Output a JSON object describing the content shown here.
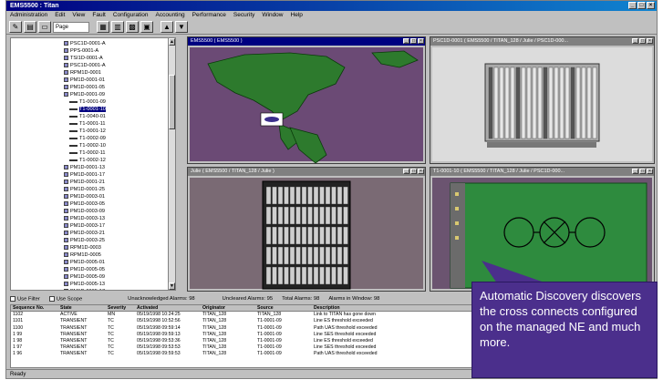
{
  "window": {
    "title": "EMS5500 : Titan",
    "ready": "Ready"
  },
  "menu": [
    "Administration",
    "Edit",
    "View",
    "Fault",
    "Configuration",
    "Accounting",
    "Performance",
    "Security",
    "Window",
    "Help"
  ],
  "toolbar": {
    "page_select": "Page"
  },
  "tree": {
    "rows": [
      {
        "label": "PSC1D-0001-A",
        "kind": "box"
      },
      {
        "label": "PPS-0001-A",
        "kind": "box"
      },
      {
        "label": "TSI1D-0001-A",
        "kind": "box"
      },
      {
        "label": "PSC1D-0001-A",
        "kind": "box"
      },
      {
        "label": "RPM1D-0001",
        "kind": "box"
      },
      {
        "label": "PM1D-0001-01",
        "kind": "box"
      },
      {
        "label": "PM1D-0001-05",
        "kind": "box"
      },
      {
        "label": "PM1D-0001-09",
        "kind": "box"
      },
      {
        "label": "T1-0001-09",
        "kind": "line"
      },
      {
        "label": "T1-0001-10",
        "kind": "line",
        "selected": true
      },
      {
        "label": "T1-0040-01",
        "kind": "line"
      },
      {
        "label": "T1-0001-11",
        "kind": "line"
      },
      {
        "label": "T1-0001-12",
        "kind": "line"
      },
      {
        "label": "T1-0002-09",
        "kind": "line"
      },
      {
        "label": "T1-0002-10",
        "kind": "line"
      },
      {
        "label": "T1-0002-11",
        "kind": "line"
      },
      {
        "label": "T1-0002-12",
        "kind": "line"
      },
      {
        "label": "PM1D-0001-13",
        "kind": "box"
      },
      {
        "label": "PM1D-0001-17",
        "kind": "box"
      },
      {
        "label": "PM1D-0001-21",
        "kind": "box"
      },
      {
        "label": "PM1D-0001-25",
        "kind": "box"
      },
      {
        "label": "PM1D-0003-01",
        "kind": "box"
      },
      {
        "label": "PM1D-0003-05",
        "kind": "box"
      },
      {
        "label": "PM1D-0003-09",
        "kind": "box"
      },
      {
        "label": "PM1D-0003-13",
        "kind": "box"
      },
      {
        "label": "PM1D-0003-17",
        "kind": "box"
      },
      {
        "label": "PM1D-0003-21",
        "kind": "box"
      },
      {
        "label": "PM1D-0003-25",
        "kind": "box"
      },
      {
        "label": "RPM1D-0003",
        "kind": "box"
      },
      {
        "label": "RPM1D-0005",
        "kind": "box"
      },
      {
        "label": "PM1D-0005-01",
        "kind": "box"
      },
      {
        "label": "PM1D-0005-05",
        "kind": "box"
      },
      {
        "label": "PM1D-0005-09",
        "kind": "box"
      },
      {
        "label": "PM1D-0005-13",
        "kind": "box"
      },
      {
        "label": "PM1D-0005-17",
        "kind": "box"
      },
      {
        "label": "PM1D-0005-21",
        "kind": "box"
      }
    ]
  },
  "panes": {
    "map_title": "EMS5500 ( EMS5500 )",
    "shelf_title": "PSC1D-0001 ( EMS5500 / TITAN_128 / Julie / PSC1D-000...",
    "rack_title": "Julie ( EMS5500 / TITAN_128 / Julie )",
    "card_title": "T1-0001-10 ( EMS5500 / TITAN_128 / Julie / PSC1D-000..."
  },
  "filters": {
    "use_filter": "Use Filter",
    "use_scope": "Use Scope",
    "unack": "Unacknowledged Alarms: 98",
    "uncleared": "Uncleared Alarms: 95",
    "total": "Total Alarms: 98",
    "in_window": "Alarms in Window: 98"
  },
  "alarms": {
    "headers": [
      "Sequence No.",
      "State",
      "Severity",
      "Activated",
      "Originator",
      "Source",
      "Description"
    ],
    "rows": [
      [
        "1102",
        "ACTIVE",
        "MN",
        "05/19/1998 10:24:25",
        "TITAN_128",
        "TITAN_128",
        "Link to TITAN has gone down"
      ],
      [
        "1101",
        "TRANSIENT",
        "TC",
        "05/19/1998 10:52:56",
        "TITAN_128",
        "T1-0001-09",
        "Line ES threshold exceeded"
      ],
      [
        "1100",
        "TRANSIENT",
        "TC",
        "05/19/1998 09:59:14",
        "TITAN_128",
        "T1-0001-09",
        "Path UAS threshold exceeded"
      ],
      [
        "1 99",
        "TRANSIENT",
        "TC",
        "05/19/1998 09:59:13",
        "TITAN_128",
        "T1-0001-09",
        "Line SES threshold exceeded"
      ],
      [
        "1 98",
        "TRANSIENT",
        "TC",
        "05/19/1998 09:53:36",
        "TITAN_128",
        "T1-0001-09",
        "Line ES threshold exceeded"
      ],
      [
        "1 97",
        "TRANSIENT",
        "TC",
        "05/19/1998 09:53:53",
        "TITAN_128",
        "T1-0001-09",
        "Line SES threshold exceeded"
      ],
      [
        "1 96",
        "TRANSIENT",
        "TC",
        "05/19/1998 09:59:53",
        "TITAN_128",
        "T1-0001-09",
        "Path UAS threshold exceeded"
      ]
    ]
  },
  "callout": {
    "text": "Automatic Discovery discovers the cross connects configured on the managed NE and much more."
  },
  "colors": {
    "accent": "#000080",
    "callout": "#4b2f8c",
    "map_land": "#2d7a2d"
  }
}
